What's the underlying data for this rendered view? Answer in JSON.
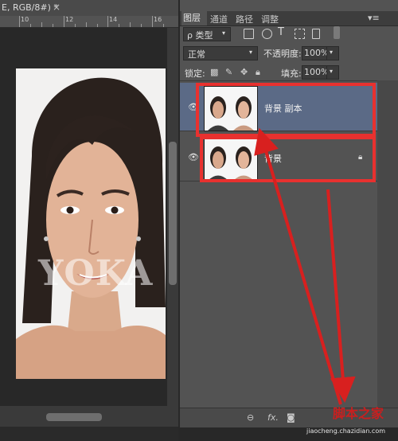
{
  "document": {
    "tab_title": "E, RGB/8#) *",
    "close_glyph": "×",
    "ruler_top_labels": [
      "10",
      "12",
      "14",
      "16"
    ],
    "watermark_text": "YOKA"
  },
  "layers_panel": {
    "tabs": [
      "图层",
      "通道",
      "路径",
      "调整"
    ],
    "menu_glyph": "▾≡",
    "filter": {
      "kind_label": "ρ 类型",
      "icons": [
        "image-filter-icon",
        "adjustment-filter-icon",
        "type-filter-icon",
        "shape-filter-icon",
        "smart-object-filter-icon"
      ]
    },
    "blend_mode": "正常",
    "opacity_label": "不透明度:",
    "opacity_value": "100%",
    "lock_label": "锁定:",
    "fill_label": "填充:",
    "fill_value": "100%",
    "layers": [
      {
        "name": "背景 副本",
        "selected": true,
        "visible": true,
        "locked": false
      },
      {
        "name": "背景",
        "selected": false,
        "visible": true,
        "locked": true
      }
    ],
    "bottom_icons": [
      "link-icon",
      "fx-icon",
      "mask-icon"
    ]
  },
  "site_watermark": {
    "main": "脚本之家",
    "sub": "jiaocheng.chazidian.com"
  },
  "colors": {
    "highlight_red": "#e8312f",
    "selected_layer": "#5b6a86",
    "panel_bg": "#535353"
  }
}
